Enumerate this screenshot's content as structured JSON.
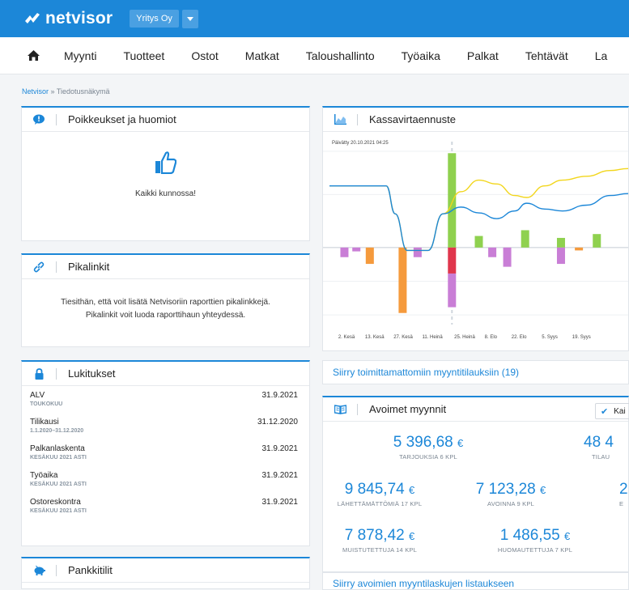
{
  "topbar": {
    "brand": "netvisor",
    "company": "Yritys Oy"
  },
  "menu": [
    "Myynti",
    "Tuotteet",
    "Ostot",
    "Matkat",
    "Taloushallinto",
    "Työaika",
    "Palkat",
    "Tehtävät",
    "La"
  ],
  "breadcrumb": {
    "root": "Netvisor",
    "sep": " » ",
    "current": "Tiedotusnäkymä"
  },
  "exceptions": {
    "title": "Poikkeukset ja huomiot",
    "message": "Kaikki kunnossa!"
  },
  "quicklinks": {
    "title": "Pikalinkit",
    "line1": "Tiesithän, että voit lisätä Netvisoriin raporttien pikalinkkejä.",
    "line2": "Pikalinkit voit luoda raporttihaun yhteydessä."
  },
  "locks": {
    "title": "Lukitukset",
    "rows": [
      {
        "name": "ALV",
        "sub": "TOUKOKUU",
        "date": "31.9.2021"
      },
      {
        "name": "Tilikausi",
        "sub": "1.1.2020–31.12.2020",
        "date": "31.12.2020"
      },
      {
        "name": "Palkanlaskenta",
        "sub": "KESÄKUU 2021 ASTI",
        "date": "31.9.2021"
      },
      {
        "name": "Työaika",
        "sub": "KESÄKUU 2021 ASTI",
        "date": "31.9.2021"
      },
      {
        "name": "Ostoreskontra",
        "sub": "KESÄKUU 2021 ASTI",
        "date": "31.9.2021"
      }
    ]
  },
  "bank": {
    "title": "Pankkitilit"
  },
  "cashflow": {
    "title": "Kassavirtaennuste",
    "updated": "Päivätty 20.10.2021 04:25",
    "link": "Siirry toimittamattomiin myyntitilauksiin (19)"
  },
  "chart_data": {
    "type": "bar",
    "categories": [
      "2. Kesä",
      "13. Kesä",
      "27. Kesä",
      "11. Heinä",
      "25. Heinä",
      "8. Elo",
      "22. Elo",
      "5. Syys",
      "19. Syys"
    ],
    "bars": [
      {
        "x": 0.05,
        "value": -10,
        "color": "#c97ed6"
      },
      {
        "x": 0.09,
        "value": -4,
        "color": "#c97ed6"
      },
      {
        "x": 0.135,
        "value": -17,
        "color": "#f59a3c"
      },
      {
        "x": 0.245,
        "value": -68,
        "color": "#f59a3c"
      },
      {
        "x": 0.295,
        "value": -10,
        "color": "#c97ed6"
      },
      {
        "x": 0.41,
        "value": 98,
        "color": "#8fd14f"
      },
      {
        "x": 0.41,
        "value": -27,
        "color": "#e0364c"
      },
      {
        "x": 0.41,
        "value": -35,
        "color": "#c97ed6"
      },
      {
        "x": 0.5,
        "value": 12,
        "color": "#8fd14f"
      },
      {
        "x": 0.545,
        "value": -10,
        "color": "#c97ed6"
      },
      {
        "x": 0.595,
        "value": -20,
        "color": "#c97ed6"
      },
      {
        "x": 0.655,
        "value": 18,
        "color": "#8fd14f"
      },
      {
        "x": 0.775,
        "value": 10,
        "color": "#8fd14f"
      },
      {
        "x": 0.775,
        "value": -17,
        "color": "#c97ed6"
      },
      {
        "x": 0.835,
        "value": -3,
        "color": "#f59a3c"
      },
      {
        "x": 0.895,
        "value": 14,
        "color": "#8fd14f"
      }
    ],
    "series": [
      {
        "color": "#f2d61c",
        "points": [
          [
            0.0,
            64
          ],
          [
            0.19,
            64
          ],
          [
            0.22,
            35
          ],
          [
            0.26,
            -3
          ],
          [
            0.33,
            -3
          ],
          [
            0.38,
            35
          ],
          [
            0.44,
            58
          ],
          [
            0.5,
            70
          ],
          [
            0.56,
            66
          ],
          [
            0.62,
            54
          ],
          [
            0.66,
            52
          ],
          [
            0.72,
            64
          ],
          [
            0.78,
            70
          ],
          [
            0.86,
            74
          ],
          [
            0.94,
            80
          ],
          [
            1.0,
            82
          ]
        ]
      },
      {
        "color": "#1c87d8",
        "points": [
          [
            0.0,
            64
          ],
          [
            0.19,
            64
          ],
          [
            0.22,
            35
          ],
          [
            0.26,
            -3
          ],
          [
            0.33,
            -3
          ],
          [
            0.38,
            35
          ],
          [
            0.44,
            42
          ],
          [
            0.5,
            36
          ],
          [
            0.56,
            30
          ],
          [
            0.62,
            38
          ],
          [
            0.66,
            46
          ],
          [
            0.72,
            40
          ],
          [
            0.78,
            38
          ],
          [
            0.86,
            44
          ],
          [
            0.94,
            54
          ],
          [
            1.0,
            56
          ]
        ]
      }
    ],
    "ylim": [
      -80,
      110
    ]
  },
  "sales": {
    "title": "Avoimet myynnit",
    "toggle": "Kai",
    "items": [
      {
        "value": "5 396,68",
        "cur": "€",
        "label": "TARJOUKSIA 6 KPL"
      },
      {
        "value": "48 4",
        "cur": "",
        "label": "TILAU"
      },
      {
        "value": "9 845,74",
        "cur": "€",
        "label": "LÄHETTÄMÄTTÖMIÄ 17 KPL"
      },
      {
        "value": "7 123,28",
        "cur": "€",
        "label": "AVOINNA 9 KPL"
      },
      {
        "value": "2",
        "cur": "",
        "label": "E"
      },
      {
        "value": "7 878,42",
        "cur": "€",
        "label": "MUISTUTETTUJA 14 KPL"
      },
      {
        "value": "1 486,55",
        "cur": "€",
        "label": "HUOMAUTETTUJA 7 KPL"
      }
    ],
    "link": "Siirry avoimien myyntilaskujen listaukseen"
  }
}
